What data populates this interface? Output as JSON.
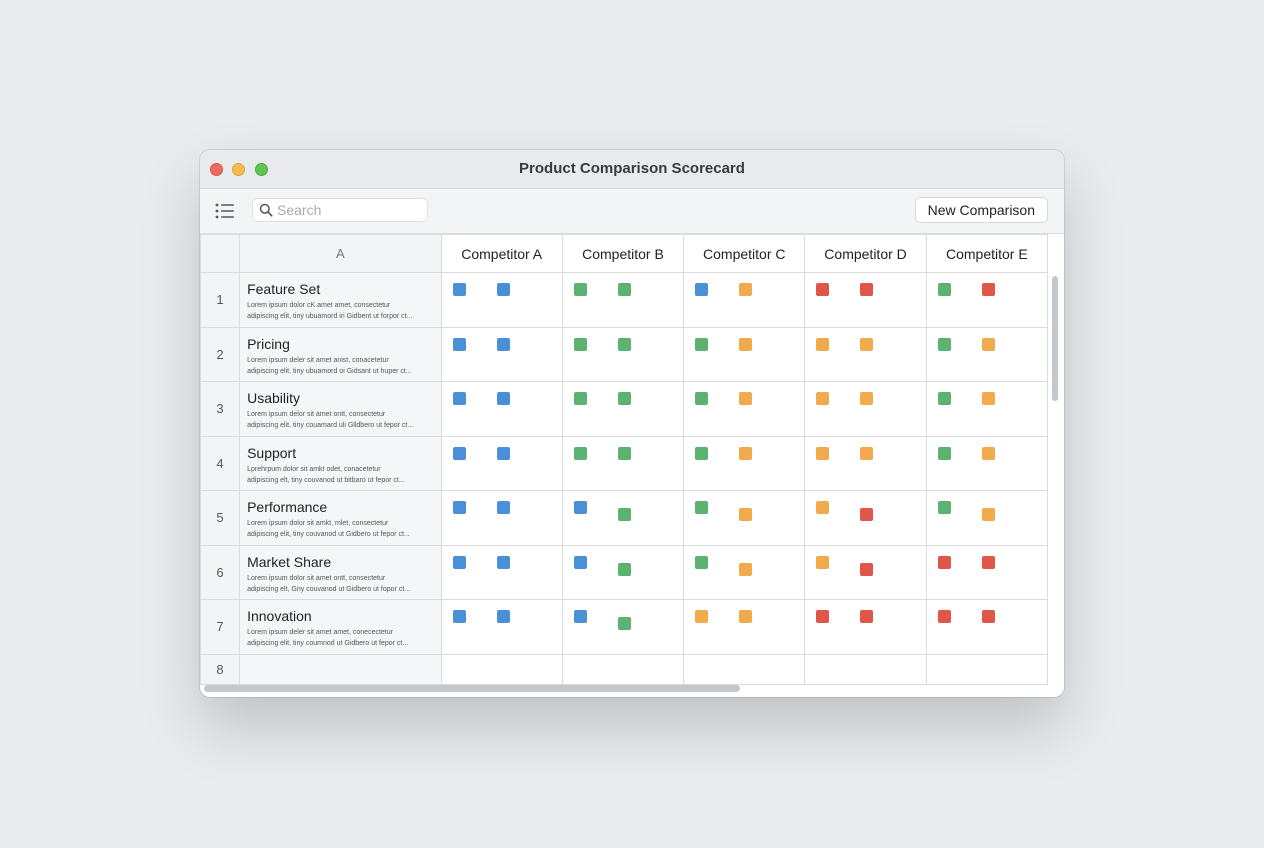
{
  "window": {
    "title": "Product Comparison Scorecard"
  },
  "toolbar": {
    "search_placeholder": "Search",
    "new_button_label": "New Comparison"
  },
  "colors": {
    "blue": "#4a90d9",
    "green": "#5cb270",
    "orange": "#f2ab4c",
    "red": "#e0574a"
  },
  "columns": {
    "row_header": "A",
    "competitors": [
      "Competitor A",
      "Competitor B",
      "Competitor C",
      "Competitor D",
      "Competitor E"
    ]
  },
  "rows": [
    {
      "num": "1",
      "name": "Feature Set",
      "desc": "Lorem ipsum dolor cK amet amet, consectetur\nadipiscing elit, tiny ubuamord iri Gidbent ut forpor ct...",
      "scores": [
        [
          "blue",
          "blue"
        ],
        [
          "green",
          "green"
        ],
        [
          "blue",
          "orange"
        ],
        [
          "red",
          "red"
        ],
        [
          "green",
          "red"
        ]
      ]
    },
    {
      "num": "2",
      "name": "Pricing",
      "desc": "Lorem ipsum deler sit amet anist, conacetetur\nadipiscing elit, tiny ubuamord oi Gidsant ut huper ct...",
      "scores": [
        [
          "blue",
          "blue"
        ],
        [
          "green",
          "green"
        ],
        [
          "green",
          "orange"
        ],
        [
          "orange",
          "orange"
        ],
        [
          "green",
          "orange"
        ]
      ]
    },
    {
      "num": "3",
      "name": "Usability",
      "desc": "Lorem ipsum delor sit amet ontt, consectetur\nadipiscing elit, tiny couamard uli Glldbero ut fepor ct...",
      "scores": [
        [
          "blue",
          "blue"
        ],
        [
          "green",
          "green"
        ],
        [
          "green",
          "orange"
        ],
        [
          "orange",
          "orange"
        ],
        [
          "green",
          "orange"
        ]
      ]
    },
    {
      "num": "4",
      "name": "Support",
      "desc": "Lprehrpum dolor sit amkt odet, conacetetur\nadipiscing elt, tiny couvanod ut bitbaro ut fepor ct...",
      "scores": [
        [
          "blue",
          "blue"
        ],
        [
          "green",
          "green"
        ],
        [
          "green",
          "orange"
        ],
        [
          "orange",
          "orange"
        ],
        [
          "green",
          "orange"
        ]
      ]
    },
    {
      "num": "5",
      "name": "Performance",
      "desc": "Lorem ipsum dolor sit amkt, mlet, consectetur\nadipiscing elit, tiny couvanod ut Gidbero ut fepor ct...",
      "scores": [
        [
          "blue",
          "blue"
        ],
        [
          "blue",
          "green"
        ],
        [
          "green",
          "orange"
        ],
        [
          "orange",
          "red"
        ],
        [
          "green",
          "orange"
        ]
      ]
    },
    {
      "num": "6",
      "name": "Market Share",
      "desc": "Lorem ipsum dolor sit amet ontt, consectetur\nadipiscing elt, Gny couvanod ut Gidbero ut fopor ct...",
      "scores": [
        [
          "blue",
          "blue"
        ],
        [
          "blue",
          "green"
        ],
        [
          "green",
          "orange"
        ],
        [
          "orange",
          "red"
        ],
        [
          "red",
          "red"
        ]
      ]
    },
    {
      "num": "7",
      "name": "Innovation",
      "desc": "Lorem ipsum deler sit amet amet, conecectetur\nadipiscing elit, tiny coumnod ut Gidbero ut fepor ct...",
      "scores": [
        [
          "blue",
          "blue"
        ],
        [
          "blue",
          "green"
        ],
        [
          "orange",
          "orange"
        ],
        [
          "red",
          "red"
        ],
        [
          "red",
          "red"
        ]
      ]
    }
  ],
  "empty_row": {
    "num": "8"
  }
}
